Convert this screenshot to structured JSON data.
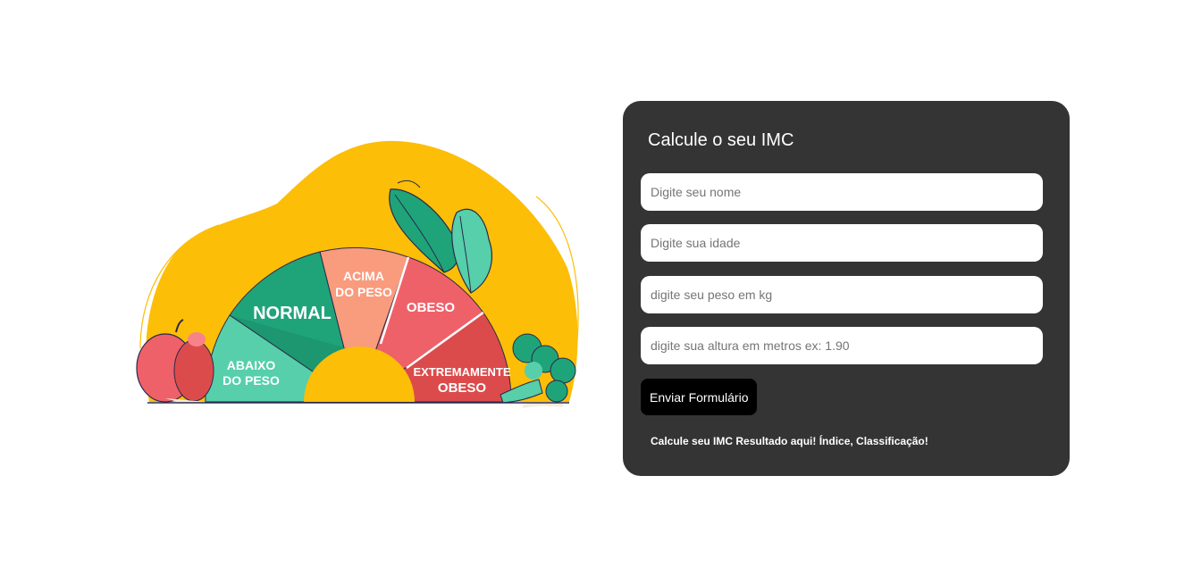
{
  "illustration": {
    "gauge_labels": {
      "abaixo": [
        "ABAIXO",
        "DO PESO"
      ],
      "normal": "NORMAL",
      "acima": [
        "ACIMA",
        "DO PESO"
      ],
      "obeso": "OBESO",
      "extremamente": [
        "EXTREMAMENTE",
        "OBESO"
      ]
    },
    "colors": {
      "blob": "#FCBE07",
      "abaixo": "#56CFAA",
      "normal": "#1FA47A",
      "acima": "#F99B7D",
      "obeso": "#EF6169",
      "extremamente": "#DC4B4B"
    }
  },
  "form": {
    "title": "Calcule o seu IMC",
    "name_placeholder": "Digite seu nome",
    "age_placeholder": "Digite sua idade",
    "weight_placeholder": "digite seu peso em kg",
    "height_placeholder": "digite sua altura em metros ex: 1.90",
    "submit_label": "Enviar Formulário",
    "result_text": "Calcule seu IMC Resultado aqui! Índice, Classificação!"
  }
}
